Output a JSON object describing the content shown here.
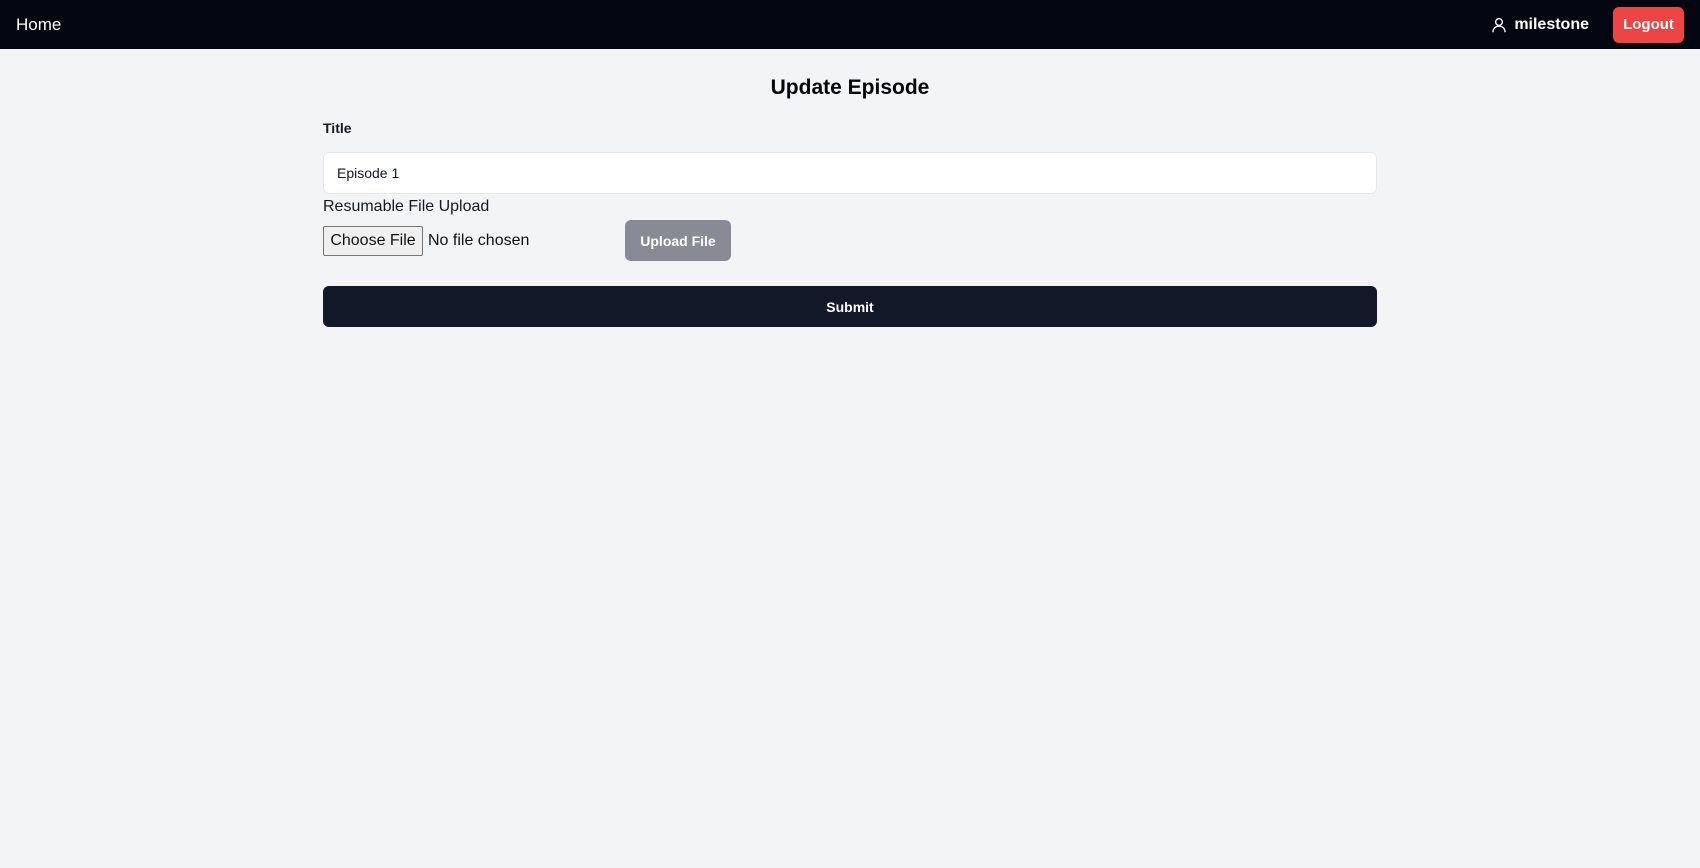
{
  "navbar": {
    "home_label": "Home",
    "user_icon": "user-icon",
    "username": "milestone",
    "logout_label": "Logout",
    "background_color": "#030712",
    "logout_color": "#ef4444"
  },
  "form": {
    "title": "Update Episode",
    "title_field_label": "Title",
    "title_value": "Episode 1",
    "upload_label": "Resumable File Upload",
    "choose_file_label": "Choose File",
    "no_file_text": "No file chosen",
    "upload_button_label": "Upload File",
    "submit_label": "Submit",
    "submit_color": "#111827",
    "upload_button_color": "#868b96"
  }
}
